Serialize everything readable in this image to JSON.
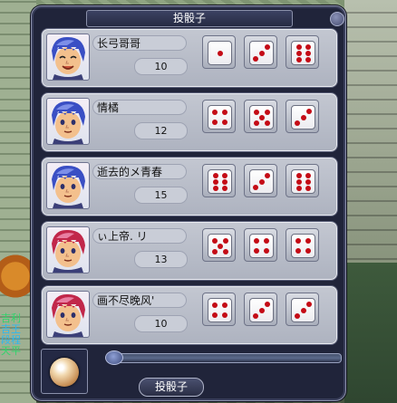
{
  "window": {
    "title": "投骰子"
  },
  "players": [
    {
      "name": "长弓哥哥",
      "score": "10",
      "dice": [
        1,
        3,
        6
      ],
      "avatar": "blue-hair-smiling-boy"
    },
    {
      "name": "情橘",
      "score": "12",
      "dice": [
        4,
        5,
        3
      ],
      "avatar": "blue-hair-boy"
    },
    {
      "name": "逝去的メ青春",
      "score": "15",
      "dice": [
        6,
        3,
        6
      ],
      "avatar": "blue-hair-boy"
    },
    {
      "name": "ぃ上帝. リ",
      "score": "13",
      "dice": [
        5,
        4,
        4
      ],
      "avatar": "red-hair-girl"
    },
    {
      "name": "画不尽晚风'",
      "score": "10",
      "dice": [
        4,
        3,
        3
      ],
      "avatar": "red-hair-girl"
    }
  ],
  "roll_button": {
    "label": "投骰子"
  },
  "side_text": {
    "line1": "吉利",
    "line2": "吉王",
    "line3": "段程",
    "line4": "天平"
  },
  "colors": {
    "pip": "#c40c16",
    "panel": "#20243a"
  }
}
